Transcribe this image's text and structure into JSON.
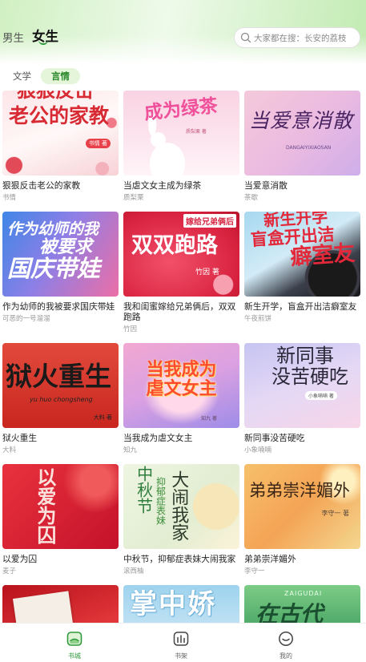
{
  "header": {
    "gender_tabs": [
      {
        "label": "男生",
        "active": false
      },
      {
        "label": "女生",
        "active": true
      }
    ],
    "search": {
      "placeholder": "大家都在搜：长安的荔枝",
      "icon": "search-icon"
    }
  },
  "category_tabs": [
    {
      "label": "文学",
      "active": false
    },
    {
      "label": "言情",
      "active": true
    }
  ],
  "books": [
    {
      "title": "狠狠反击老公的家教",
      "author": "书情",
      "cover": {
        "lines": [
          "狠狠反击",
          "老公的家教"
        ],
        "note": "书情 著"
      }
    },
    {
      "title": "当虐文女主成为绿茶",
      "author": "质梨栗",
      "cover": {
        "lines": [
          "成为绿茶"
        ],
        "note": "质梨栗 著"
      }
    },
    {
      "title": "当爱意消散",
      "author": "茶歇",
      "cover": {
        "lines": [
          "当爱意消散"
        ],
        "sub": "DANGAIYIXIAOSAN"
      }
    },
    {
      "title": "作为幼师的我被要求国庆带娃",
      "author": "可恶的一号溜溜",
      "cover": {
        "lines": [
          "作为幼师的我",
          "被要求",
          "国庆带娃"
        ]
      }
    },
    {
      "title": "我和闺蜜嫁给兄弟俩后，双双跑路",
      "author": "竹因",
      "cover": {
        "tag": "嫁给兄弟俩后",
        "lines": [
          "双双跑路"
        ],
        "note": "竹因 著"
      }
    },
    {
      "title": "新生开学，盲盒开出洁癖室友",
      "author": "午夜煎饼",
      "cover": {
        "lines": [
          "新生开学",
          "盲盒开出洁",
          "癖室友"
        ]
      }
    },
    {
      "title": "狱火重生",
      "author": "大料",
      "cover": {
        "lines": [
          "狱火重生"
        ],
        "sub": "yu huo chongsheng",
        "note": "大料 著"
      }
    },
    {
      "title": "当我成为虐文女主",
      "author": "知九",
      "cover": {
        "lines": [
          "当我成为",
          "虐文女主"
        ],
        "note": "知九 著"
      }
    },
    {
      "title": "新同事没苦硬吃",
      "author": "小象喃喃",
      "cover": {
        "lines": [
          "新同事",
          "没苦硬吃"
        ],
        "note": "小象喃喃 著"
      }
    },
    {
      "title": "以爱为囚",
      "author": "麦子",
      "cover": {
        "lines": [
          "以爱为囚"
        ]
      }
    },
    {
      "title": "中秋节，抑郁症表妹大闹我家",
      "author": "滚西柚",
      "cover": {
        "lines": [
          "中秋节",
          "抑郁症表妹",
          "大闹我家"
        ]
      }
    },
    {
      "title": "弟弟崇洋媚外",
      "author": "李守一",
      "cover": {
        "lines": [
          "弟弟崇洋媚外"
        ],
        "note": "李守一 著"
      }
    },
    {
      "cover": {
        "lines": []
      }
    },
    {
      "cover": {
        "lines": [
          "掌中娇"
        ]
      }
    },
    {
      "cover": {
        "sub": "ZAIGUDAI",
        "lines": [
          "在古代"
        ]
      }
    }
  ],
  "bottom_nav": [
    {
      "label": "书城",
      "icon": "bookstore-icon",
      "active": true
    },
    {
      "label": "书架",
      "icon": "bookshelf-icon",
      "active": false
    },
    {
      "label": "我的",
      "icon": "profile-icon",
      "active": false
    }
  ],
  "colors": {
    "accent": "#2f9a3c",
    "header_green": "#c2ebb2",
    "active_pill": "#e4f5da"
  }
}
